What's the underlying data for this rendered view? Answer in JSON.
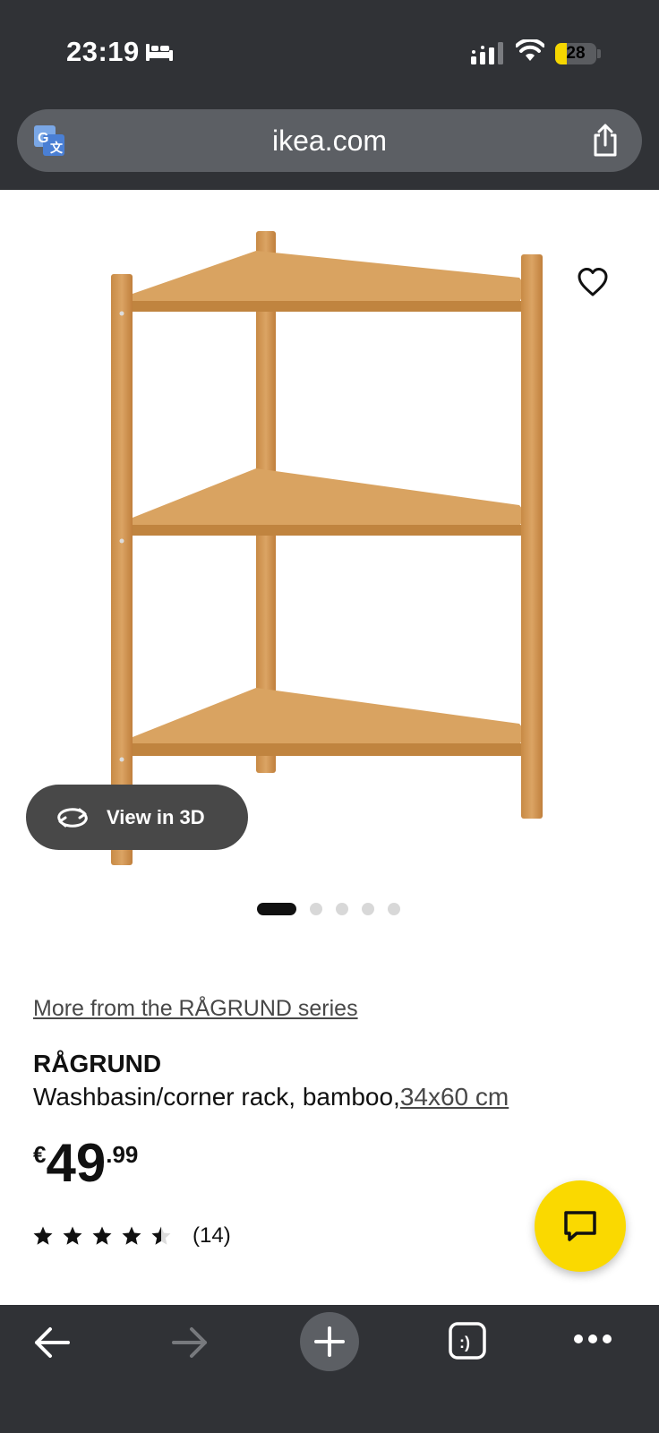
{
  "status_bar": {
    "time": "23:19",
    "battery": "28",
    "battery_level": 0.28
  },
  "address_bar": {
    "url": "ikea.com"
  },
  "gallery": {
    "view_3d_label": "View in 3D",
    "image_count": 5,
    "active_index": 0
  },
  "product": {
    "series_link": "More from the RÅGRUND series",
    "name": "RÅGRUND",
    "description": "Washbasin/corner rack, bamboo,",
    "size": "34x60 cm",
    "price": {
      "currency": "€",
      "integer": "49",
      "decimal": ".99"
    },
    "rating": 4.5,
    "reviews": "(14)"
  },
  "colors": {
    "chrome": "#303236",
    "accent_yellow": "#fad900",
    "text": "#111111"
  },
  "icons": {
    "status": [
      "bed-icon",
      "signal-icon",
      "wifi-icon"
    ],
    "address": [
      "translate-icon",
      "share-icon"
    ],
    "toolbar": [
      "back-arrow-icon",
      "forward-arrow-icon",
      "plus-icon",
      "tabs-icon",
      "more-icon"
    ],
    "page": [
      "heart-icon",
      "rotate-3d-icon",
      "chat-icon"
    ]
  }
}
